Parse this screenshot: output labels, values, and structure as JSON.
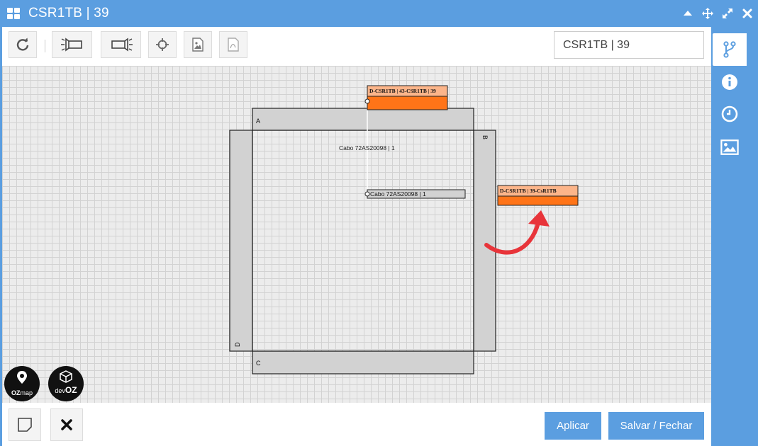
{
  "window": {
    "title": "CSR1TB | 39"
  },
  "search": {
    "value": "CSR1TB | 39"
  },
  "diagram": {
    "side_a": "A",
    "side_b": "B",
    "side_c": "C",
    "side_d": "D",
    "top_connector": "D-CSR1TB | 43-CSR1TB | 39",
    "right_connector": "D-CSR1TB | 39-CsR1TB",
    "cable_label": "Cabo 72AS20098 | 1",
    "cable_port_label": "Cabo 72AS20098 | 1"
  },
  "logos": {
    "ozmap_line1": "OZ",
    "ozmap_line2": "map",
    "devoz_line1": "dev",
    "devoz_line2": "OZ"
  },
  "footer": {
    "apply_label": "Aplicar",
    "save_close_label": "Salvar / Fechar"
  },
  "colors": {
    "accent": "#5b9ee0",
    "connector_header": "#fcb58a",
    "connector_body": "#ff7418",
    "arrow": "#e8343a"
  }
}
